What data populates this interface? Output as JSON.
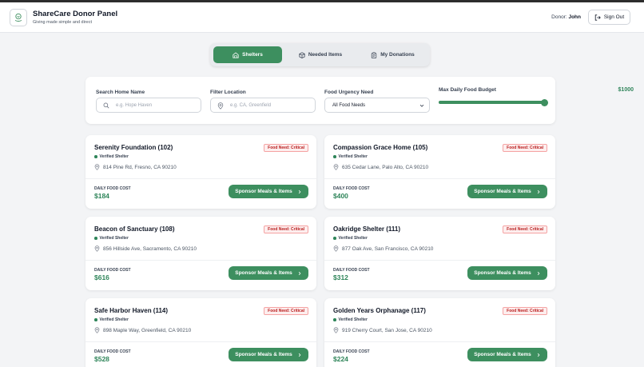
{
  "app": {
    "title": "ShareCare Donor Panel",
    "subtitle": "Giving made simple and direct",
    "donor_label": "Donor:",
    "donor_name": "John",
    "signout_label": "Sign Out"
  },
  "tabs": [
    {
      "label": "Shelters",
      "icon": "house-icon",
      "active": true
    },
    {
      "label": "Needed Items",
      "icon": "box-icon",
      "active": false
    },
    {
      "label": "My Donations",
      "icon": "clipboard-icon",
      "active": false
    }
  ],
  "filters": {
    "search": {
      "label": "Search Home Name",
      "placeholder": "e.g. Hope Haven",
      "value": ""
    },
    "location": {
      "label": "Filter Location",
      "placeholder": "e.g. CA, Greenfield",
      "value": ""
    },
    "urgency": {
      "label": "Food Urgency Need",
      "selected": "All Food Needs"
    },
    "budget": {
      "label": "Max Daily Food Budget",
      "value_text": "$1000",
      "fraction": 1.0
    }
  },
  "colors": {
    "accent": "#3d8f5f",
    "accent_text": "#2f855a",
    "critical": "#b91c1c",
    "critical_bg": "#fdeeee"
  },
  "shelters": [
    {
      "name": "Serenity Foundation (102)",
      "badge": "Food Need: Critical",
      "verified": "Verified Shelter",
      "address": "814 Pine Rd, Fresno, CA 90210",
      "cost_label": "DAILY FOOD COST",
      "cost": "$184",
      "action": "Sponsor Meals & Items"
    },
    {
      "name": "Compassion Grace Home (105)",
      "badge": "Food Need: Critical",
      "verified": "Verified Shelter",
      "address": "635 Cedar Lane, Palo Alto, CA 90210",
      "cost_label": "DAILY FOOD COST",
      "cost": "$400",
      "action": "Sponsor Meals & Items"
    },
    {
      "name": "Beacon of Sanctuary (108)",
      "badge": "Food Need: Critical",
      "verified": "Verified Shelter",
      "address": "856 Hillside Ave, Sacramento, CA 90210",
      "cost_label": "DAILY FOOD COST",
      "cost": "$616",
      "action": "Sponsor Meals & Items"
    },
    {
      "name": "Oakridge Shelter (111)",
      "badge": "Food Need: Critical",
      "verified": "Verified Shelter",
      "address": "877 Oak Ave, San Francisco, CA 90210",
      "cost_label": "DAILY FOOD COST",
      "cost": "$312",
      "action": "Sponsor Meals & Items"
    },
    {
      "name": "Safe Harbor Haven (114)",
      "badge": "Food Need: Critical",
      "verified": "Verified Shelter",
      "address": "898 Maple Way, Greenfield, CA 90210",
      "cost_label": "DAILY FOOD COST",
      "cost": "$528",
      "action": "Sponsor Meals & Items"
    },
    {
      "name": "Golden Years Orphanage (117)",
      "badge": "Food Need: Critical",
      "verified": "Verified Shelter",
      "address": "919 Cherry Court, San Jose, CA 90210",
      "cost_label": "DAILY FOOD COST",
      "cost": "$224",
      "action": "Sponsor Meals & Items"
    }
  ]
}
